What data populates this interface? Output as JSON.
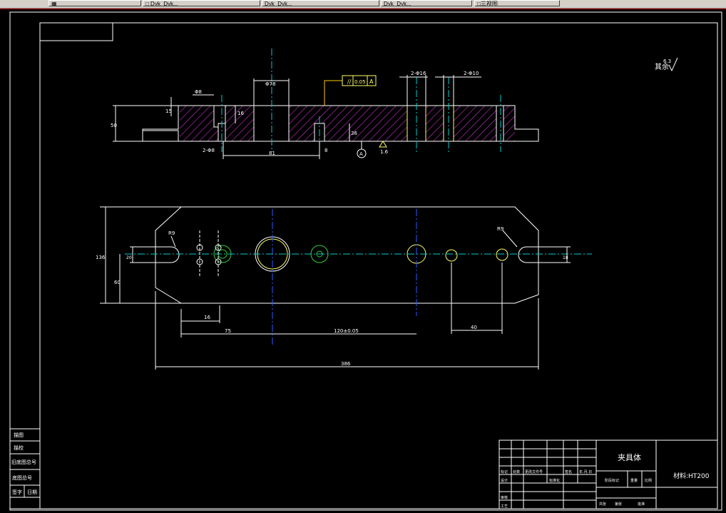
{
  "taskbar": {
    "buttons": [
      {
        "label": "▦"
      },
      {
        "label": "□ Dyk_Dyk..."
      },
      {
        "label": "Dyk_Dyk..."
      },
      {
        "label": "Dyk_Dyk..."
      },
      {
        "label": "□三视图"
      }
    ]
  },
  "colors": {
    "background": "#000000",
    "line": "#ffffff",
    "hatch": "#cc33cc",
    "centerline_cyan": "#00cccc",
    "centerline_blue": "#2a5cff",
    "hole_yellow": "#ffff66",
    "hole_green": "#33cc33",
    "leader_yellow": "#ffcc00"
  },
  "front_view": {
    "dims": {
      "d_top_left": "Φ8",
      "d_top_mid": "Φ78",
      "d_top_r1": "2-Φ16",
      "d_top_r2": "2-Φ10",
      "d_bottom_left": "2-Φ8",
      "d_bottom_mid": "8",
      "d_bottom_span": "81",
      "d_left_h": "15",
      "d_right_h": "36",
      "d_mid_h": "16",
      "d_side_v": "50"
    },
    "tolerance": {
      "symbol": "//",
      "value": "0.05",
      "datum": "A"
    },
    "datum_label": "A",
    "roughness": "1.6"
  },
  "top_view": {
    "dims": {
      "height_total": "136",
      "height_half": "60",
      "slot_w_left": "20",
      "slot_w_right": "18",
      "R_left": "R9",
      "R_right": "R9",
      "d_16": "16",
      "d_75": "75",
      "d_center": "120±0.05",
      "d_40": "40",
      "d_total": "386"
    }
  },
  "roughness_mark": {
    "text": "其余",
    "value": "6.3"
  },
  "title_block": {
    "part_name": "夹具体",
    "material": "材料:HT200",
    "labels": [
      "标记",
      "处数",
      "更改文件号",
      "签名",
      "年.月.日",
      "设计",
      "标准化",
      "审核",
      "工艺",
      "阶段标记",
      "重量",
      "比例",
      "共张",
      "第张",
      "批准"
    ]
  },
  "side_table": {
    "rows": [
      "描图",
      "描校",
      "旧底图总号",
      "底图总号",
      "签字",
      "日期"
    ]
  }
}
